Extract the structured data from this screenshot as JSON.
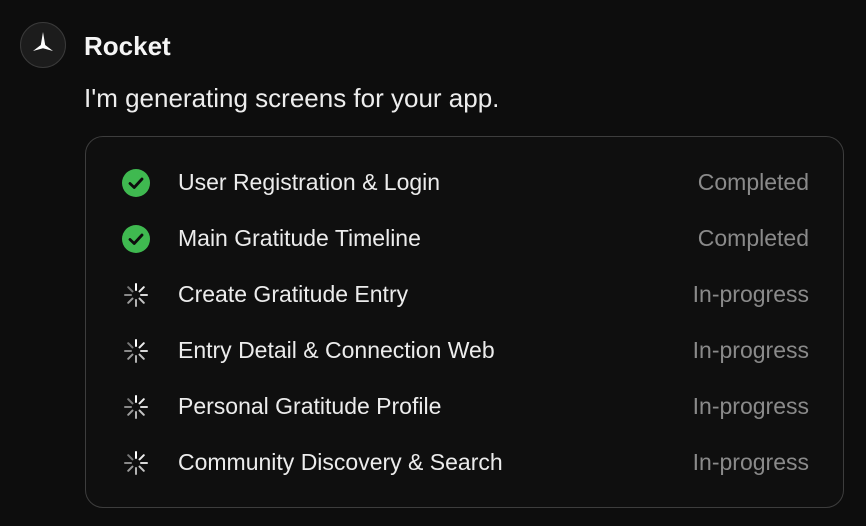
{
  "chat": {
    "sender": "Rocket",
    "avatar_icon": "rocket-logo-icon",
    "message": "I'm generating screens for your app."
  },
  "screens": [
    {
      "name": "User Registration & Login",
      "status": "Completed",
      "icon": "check-circle-icon"
    },
    {
      "name": "Main Gratitude Timeline",
      "status": "Completed",
      "icon": "check-circle-icon"
    },
    {
      "name": "Create Gratitude Entry",
      "status": "In-progress",
      "icon": "spinner-icon"
    },
    {
      "name": "Entry Detail & Connection Web",
      "status": "In-progress",
      "icon": "spinner-icon"
    },
    {
      "name": "Personal Gratitude Profile",
      "status": "In-progress",
      "icon": "spinner-icon"
    },
    {
      "name": "Community Discovery & Search",
      "status": "In-progress",
      "icon": "spinner-icon"
    }
  ],
  "colors": {
    "background": "#0d0d0d",
    "completed": "#3fb950",
    "status_text": "#8a8a8a"
  }
}
